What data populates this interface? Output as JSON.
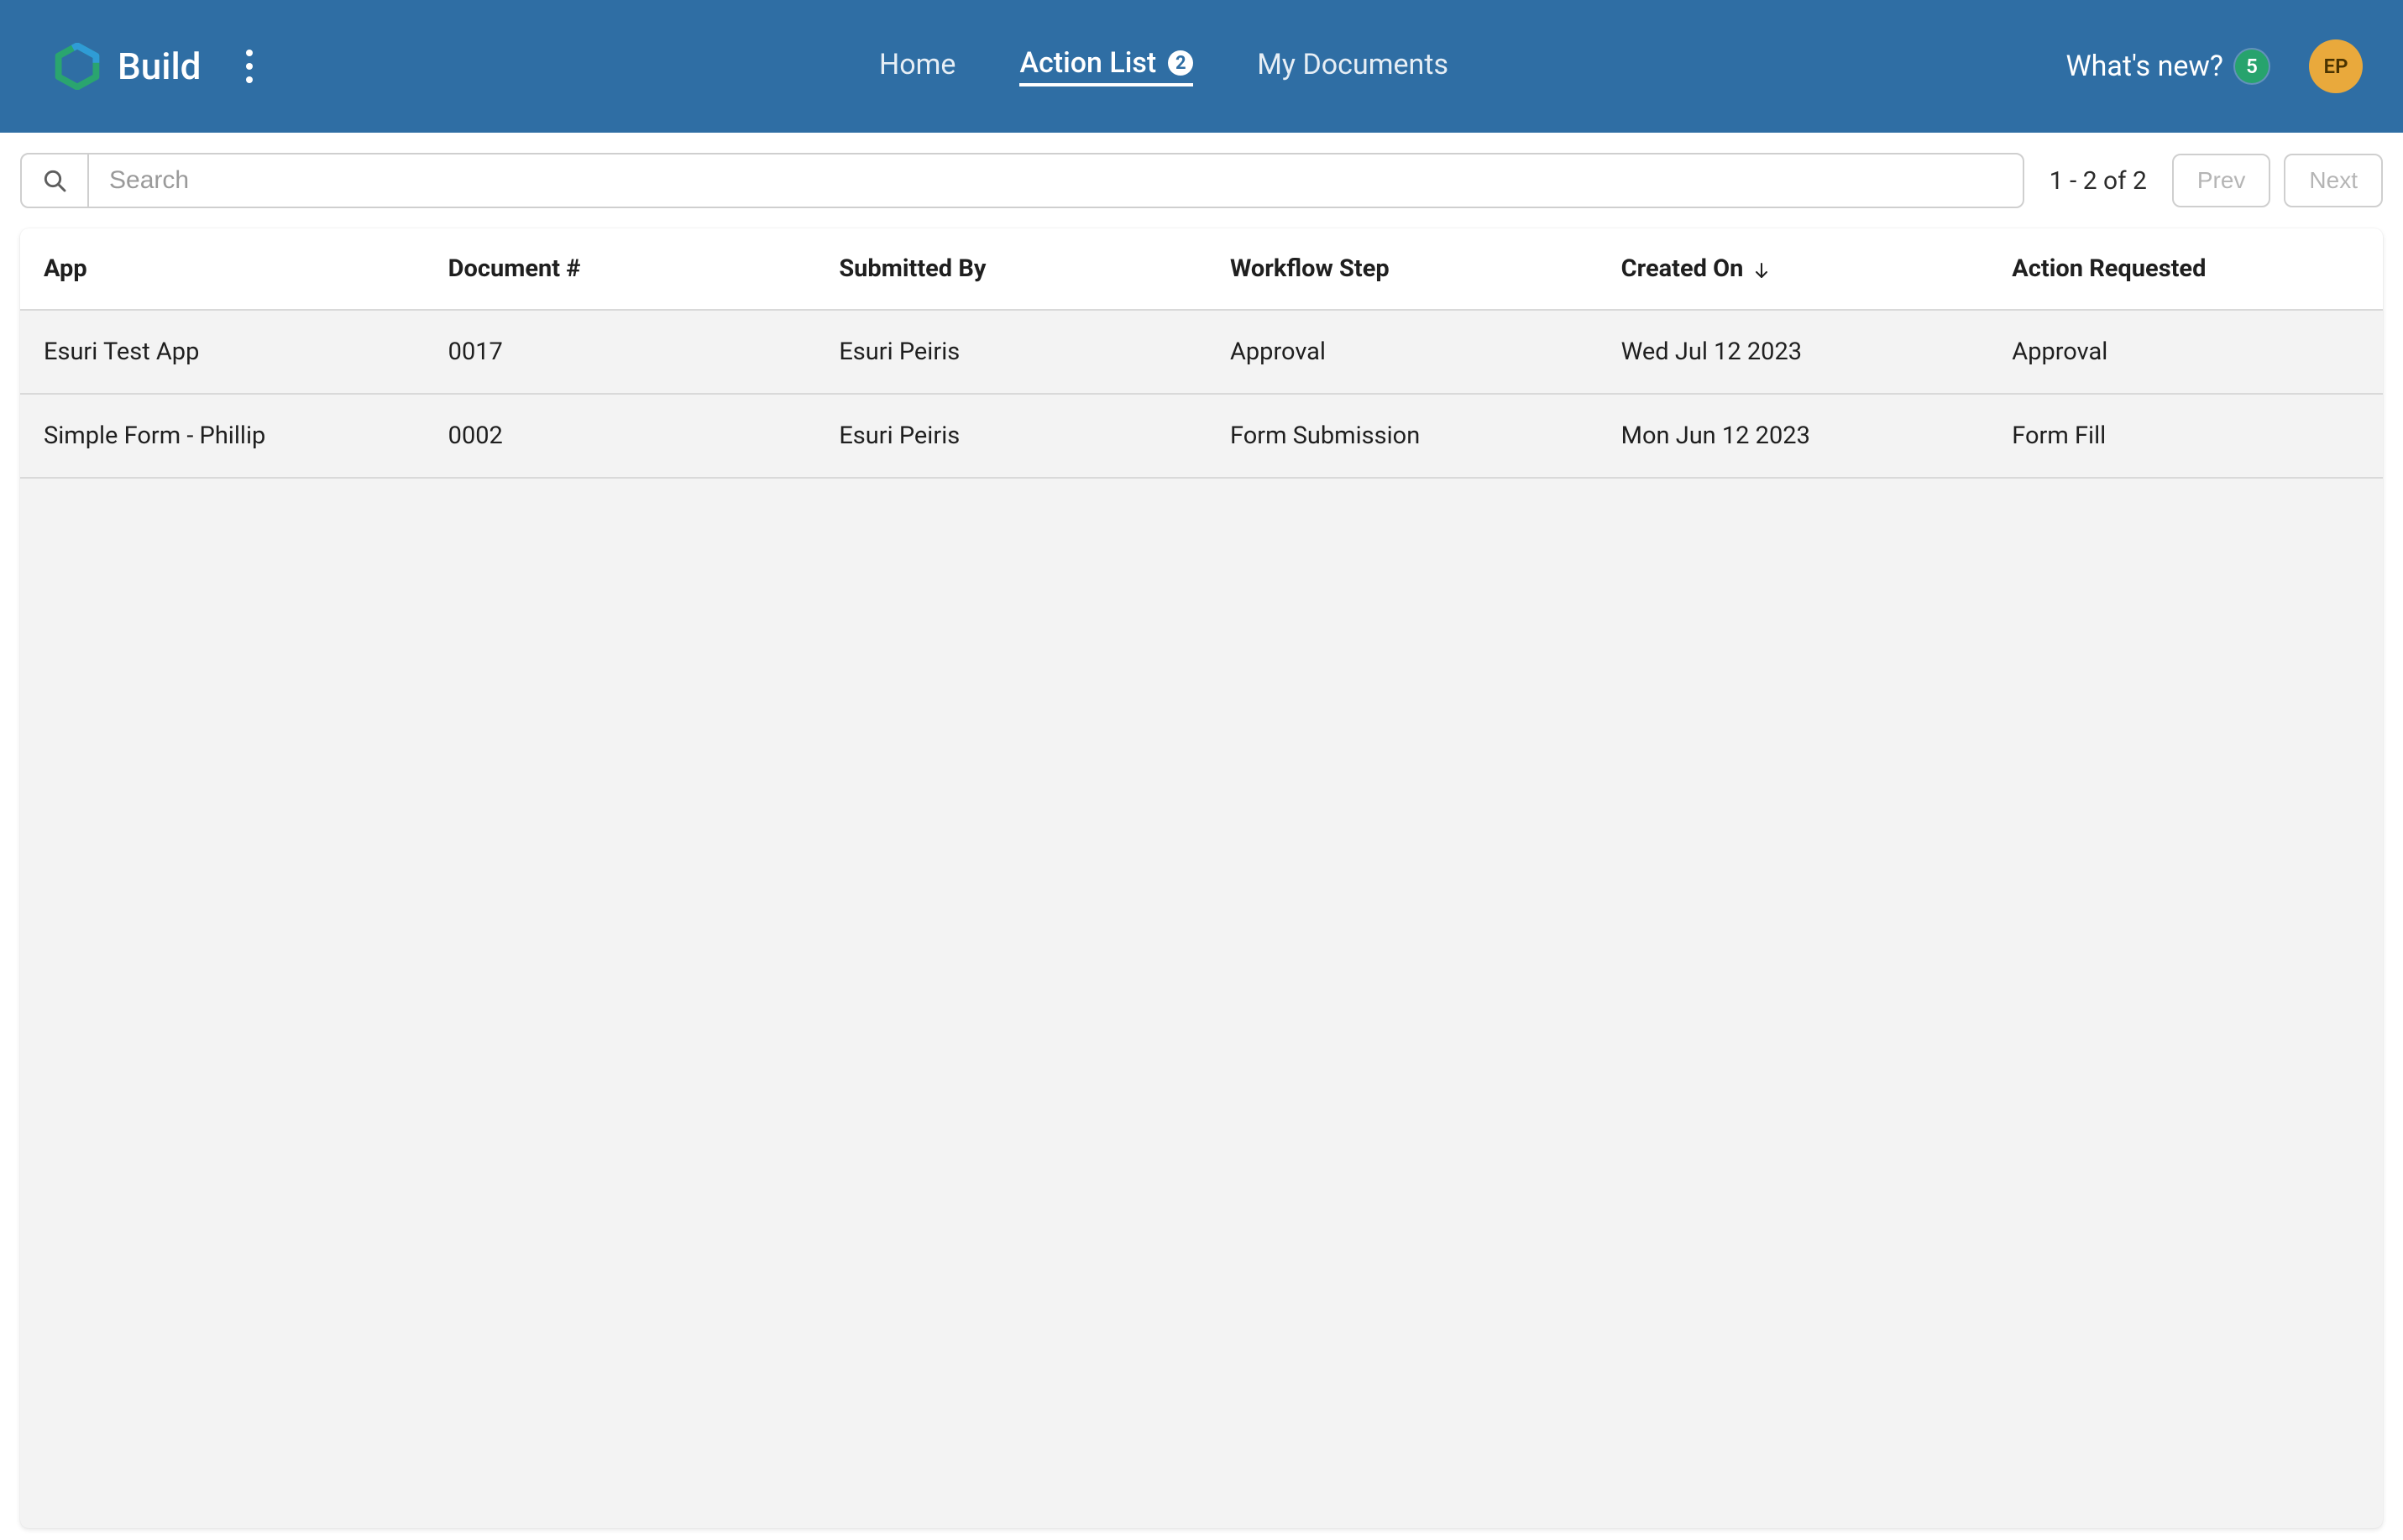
{
  "brand": {
    "name": "Build"
  },
  "nav": {
    "home": "Home",
    "action_list": "Action List",
    "action_list_badge": "2",
    "my_documents": "My Documents"
  },
  "header_right": {
    "whats_new": "What's new?",
    "whats_new_badge": "5",
    "avatar_initials": "EP"
  },
  "toolbar": {
    "search_placeholder": "Search",
    "page_info": "1 - 2 of 2",
    "prev_label": "Prev",
    "next_label": "Next"
  },
  "columns": {
    "app": "App",
    "doc": "Document #",
    "submitted_by": "Submitted By",
    "workflow_step": "Workflow Step",
    "created_on": "Created On",
    "action_requested": "Action Requested"
  },
  "rows": [
    {
      "app": "Esuri Test App",
      "doc": "0017",
      "submitted_by": "Esuri Peiris",
      "workflow_step": "Approval",
      "created_on": "Wed Jul 12 2023",
      "action_requested": "Approval"
    },
    {
      "app": "Simple Form - Phillip",
      "doc": "0002",
      "submitted_by": "Esuri Peiris",
      "workflow_step": "Form Submission",
      "created_on": "Mon Jun 12 2023",
      "action_requested": "Form Fill"
    }
  ]
}
